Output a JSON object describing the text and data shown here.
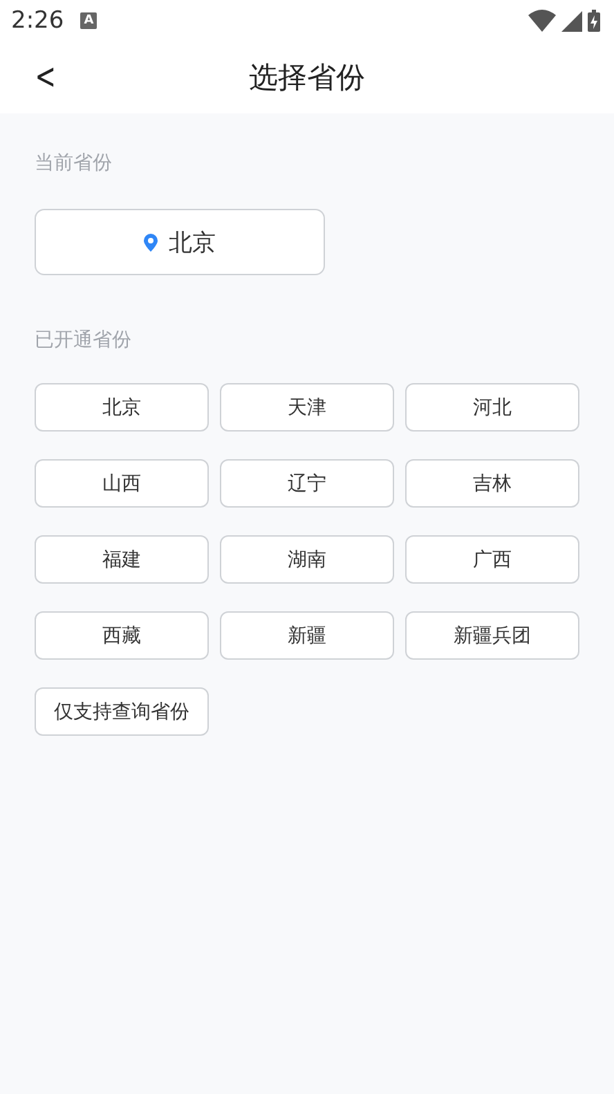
{
  "status_bar": {
    "time": "2:26",
    "notification": "A"
  },
  "header": {
    "title": "选择省份",
    "back": "<"
  },
  "current": {
    "label": "当前省份",
    "province": "北京"
  },
  "opened": {
    "label": "已开通省份",
    "provinces": [
      "北京",
      "天津",
      "河北",
      "山西",
      "辽宁",
      "吉林",
      "福建",
      "湖南",
      "广西",
      "西藏",
      "新疆",
      "新疆兵团"
    ],
    "note": "仅支持查询省份"
  }
}
